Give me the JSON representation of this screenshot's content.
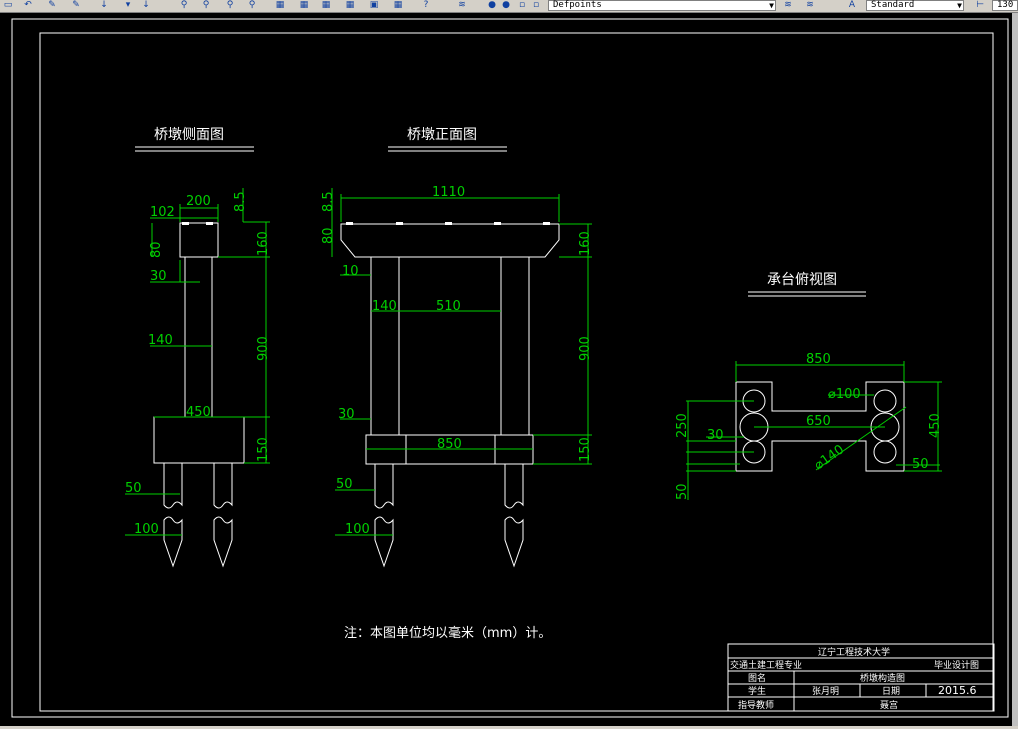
{
  "toolbar": {
    "layer_value": "Defpoints",
    "style_value": "Standard",
    "right_value": "130"
  },
  "drawing": {
    "side_view": {
      "title": "桥墩侧面图",
      "dims": {
        "d200": "200",
        "d8_5": "8.5",
        "d102": "102",
        "d80": "80",
        "d160": "160",
        "d30": "30",
        "d140": "140",
        "d900": "900",
        "d450": "450",
        "d150": "150",
        "d50": "50",
        "d100": "100"
      }
    },
    "front_view": {
      "title": "桥墩正面图",
      "dims": {
        "d1110": "1110",
        "d8_5": "8.5",
        "d80": "80",
        "d160": "160",
        "d10": "10",
        "d140": "140",
        "d510": "510",
        "d900": "900",
        "d30": "30",
        "d850": "850",
        "d150": "150",
        "d50": "50",
        "d100": "100"
      }
    },
    "plan_view": {
      "title": "承台俯视图",
      "dims": {
        "d850": "850",
        "d100": "⌀100",
        "d250": "250",
        "d30": "30",
        "d650": "650",
        "d450": "450",
        "d140": "⌀140",
        "d50a": "50",
        "d50b": "50"
      }
    },
    "note": "注：本图单位均以毫米（mm）计。",
    "title_block": {
      "university": "辽宁工程技术大学",
      "major": "交通土建工程专业",
      "design_type": "毕业设计图",
      "drawing_name_label": "图名",
      "drawing_name": "桥墩构造图",
      "student_label": "学生",
      "student": "张月明",
      "date_label": "日期",
      "date": "2015.6",
      "advisor_label": "指导教师",
      "advisor": "聂宫"
    }
  }
}
